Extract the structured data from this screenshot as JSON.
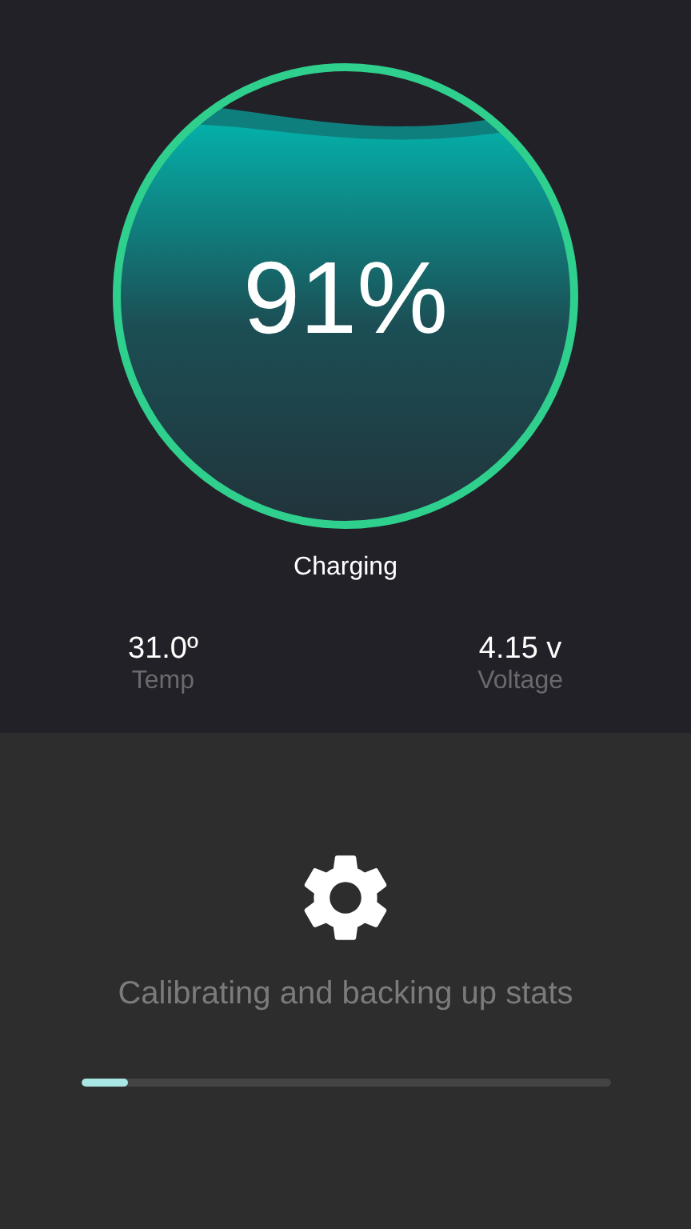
{
  "battery": {
    "percent": "91%",
    "status": "Charging"
  },
  "stats": [
    {
      "value": "31.0º",
      "label": "Temp"
    },
    {
      "value": "4.15 v",
      "label": "Voltage"
    }
  ],
  "calibration": {
    "message": "Calibrating and backing up stats",
    "level": 0.09
  }
}
